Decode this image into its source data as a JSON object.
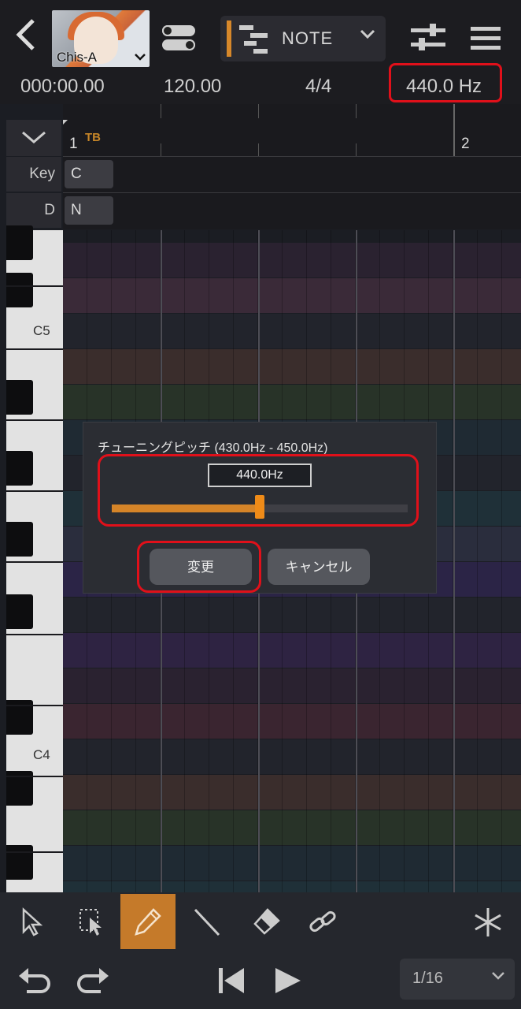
{
  "top_bar": {
    "singer_name": "Chis-A",
    "mode_label": "NOTE",
    "accent_color": "#d7882a"
  },
  "info_bar": {
    "time": "000:00.00",
    "tempo": "120.00",
    "time_signature": "4/4",
    "tuning": "440.0 Hz"
  },
  "ruler": {
    "tb_label": "TB",
    "measures": [
      "1",
      "2"
    ]
  },
  "tracks": {
    "key_label": "Key",
    "key_value": "C",
    "d_label": "D",
    "d_value": "N"
  },
  "piano": {
    "labels": [
      "C5",
      "C4"
    ]
  },
  "dialog": {
    "title": "チューニングピッチ (430.0Hz - 450.0Hz)",
    "value": "440.0Hz",
    "slider_fraction": 0.5,
    "confirm_label": "変更",
    "cancel_label": "キャンセル"
  },
  "toolbar": {
    "tools": [
      "select-arrow-icon",
      "marquee-select-icon",
      "pencil-icon",
      "line-icon",
      "eraser-icon",
      "link-icon",
      "snowflake-icon"
    ],
    "active_tool": "pencil-icon",
    "snap_value": "1/16"
  },
  "highlight_color": "#e0101a"
}
